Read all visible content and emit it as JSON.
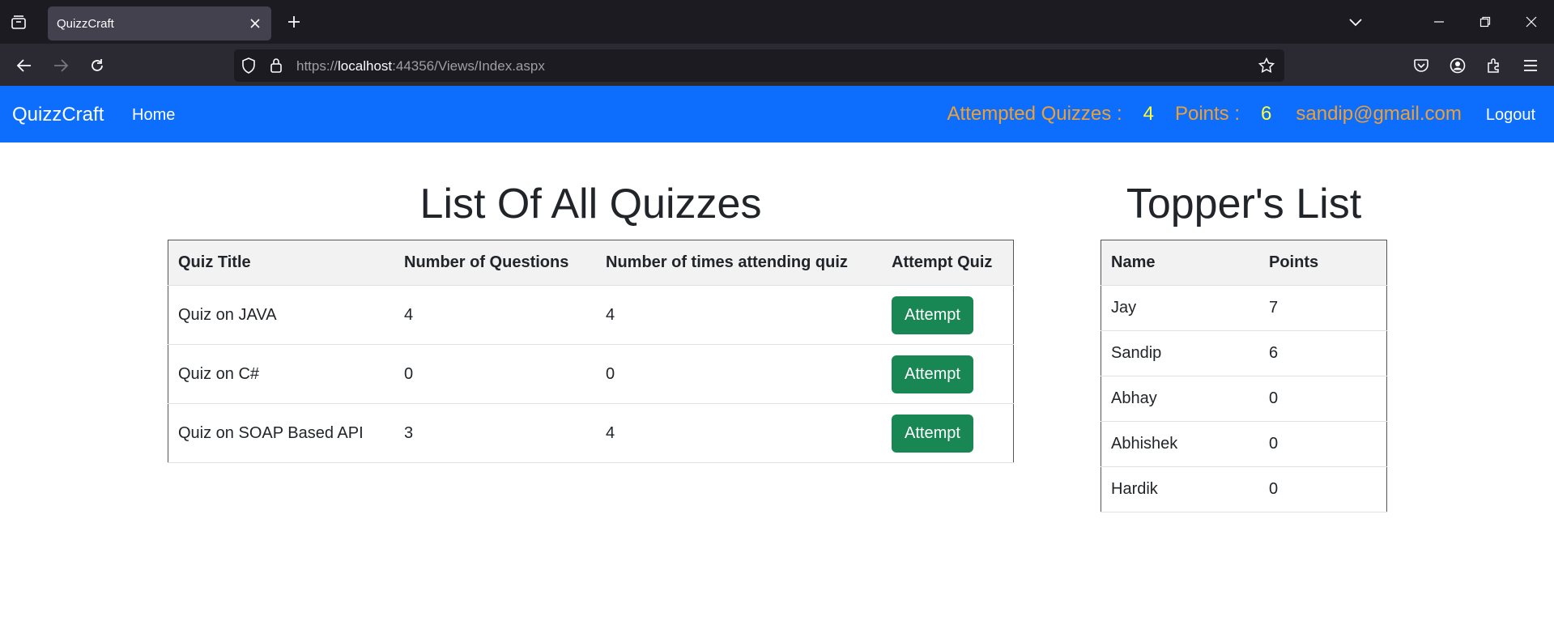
{
  "browser": {
    "tab_title": "QuizzCraft",
    "url_scheme": "https://",
    "url_host": "localhost",
    "url_rest": ":44356/Views/Index.aspx"
  },
  "navbar": {
    "brand": "QuizzCraft",
    "home": "Home",
    "attempted_label": "Attempted Quizzes :",
    "attempted_count": "4",
    "points_label": "Points :",
    "points_value": "6",
    "email": "sandip@gmail.com",
    "logout": "Logout"
  },
  "quizzes": {
    "heading": "List Of All Quizzes",
    "columns": [
      "Quiz Title",
      "Number of Questions",
      "Number of times attending quiz",
      "Attempt Quiz"
    ],
    "rows": [
      {
        "title": "Quiz on JAVA",
        "questions": "4",
        "attempts": "4",
        "action": "Attempt"
      },
      {
        "title": "Quiz on C#",
        "questions": "0",
        "attempts": "0",
        "action": "Attempt"
      },
      {
        "title": "Quiz on SOAP Based API",
        "questions": "3",
        "attempts": "4",
        "action": "Attempt"
      }
    ]
  },
  "toppers": {
    "heading": "Topper's List",
    "columns": [
      "Name",
      "Points"
    ],
    "rows": [
      {
        "name": "Jay",
        "points": "7"
      },
      {
        "name": "Sandip",
        "points": "6"
      },
      {
        "name": "Abhay",
        "points": "0"
      },
      {
        "name": "Abhishek",
        "points": "0"
      },
      {
        "name": "Hardik",
        "points": "0"
      }
    ]
  },
  "colors": {
    "navbar": "#0d6efd",
    "attempt_button": "#198754",
    "label_orange": "#f0a030",
    "value_yellow": "#ffff33"
  },
  "icons": {
    "tab_list": "tab-list-icon",
    "close": "close-icon",
    "new_tab": "plus-icon",
    "back": "back-arrow-icon",
    "forward": "forward-arrow-icon",
    "reload": "reload-icon",
    "shield": "shield-icon",
    "lock": "lock-icon",
    "bookmark": "star-icon",
    "pocket": "pocket-icon",
    "account": "account-icon",
    "extensions": "extensions-icon",
    "menu": "hamburger-menu-icon"
  }
}
